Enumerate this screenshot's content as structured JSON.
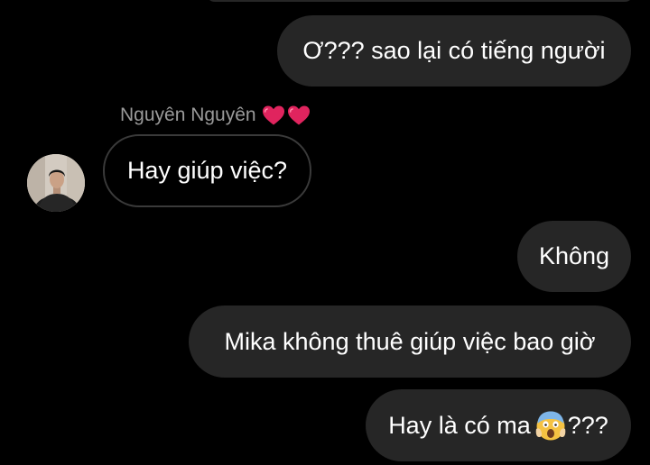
{
  "chat": {
    "sender_name": "Nguyên Nguyên",
    "messages": [
      {
        "text": "Ơ??? sao lại có tiếng người"
      },
      {
        "text": "Hay giúp việc?"
      },
      {
        "text": "Không"
      },
      {
        "text": "Mika không thuê giúp việc bao giờ"
      },
      {
        "text_before": "Hay là có ma",
        "emoji": "face-screaming-in-fear-icon",
        "text_after": "???"
      }
    ]
  },
  "colors": {
    "background": "#000000",
    "outgoing_bubble": "#262626",
    "incoming_border": "#3a3a3a",
    "sender_name": "#9a9a9a",
    "heart": "#e0245e"
  }
}
